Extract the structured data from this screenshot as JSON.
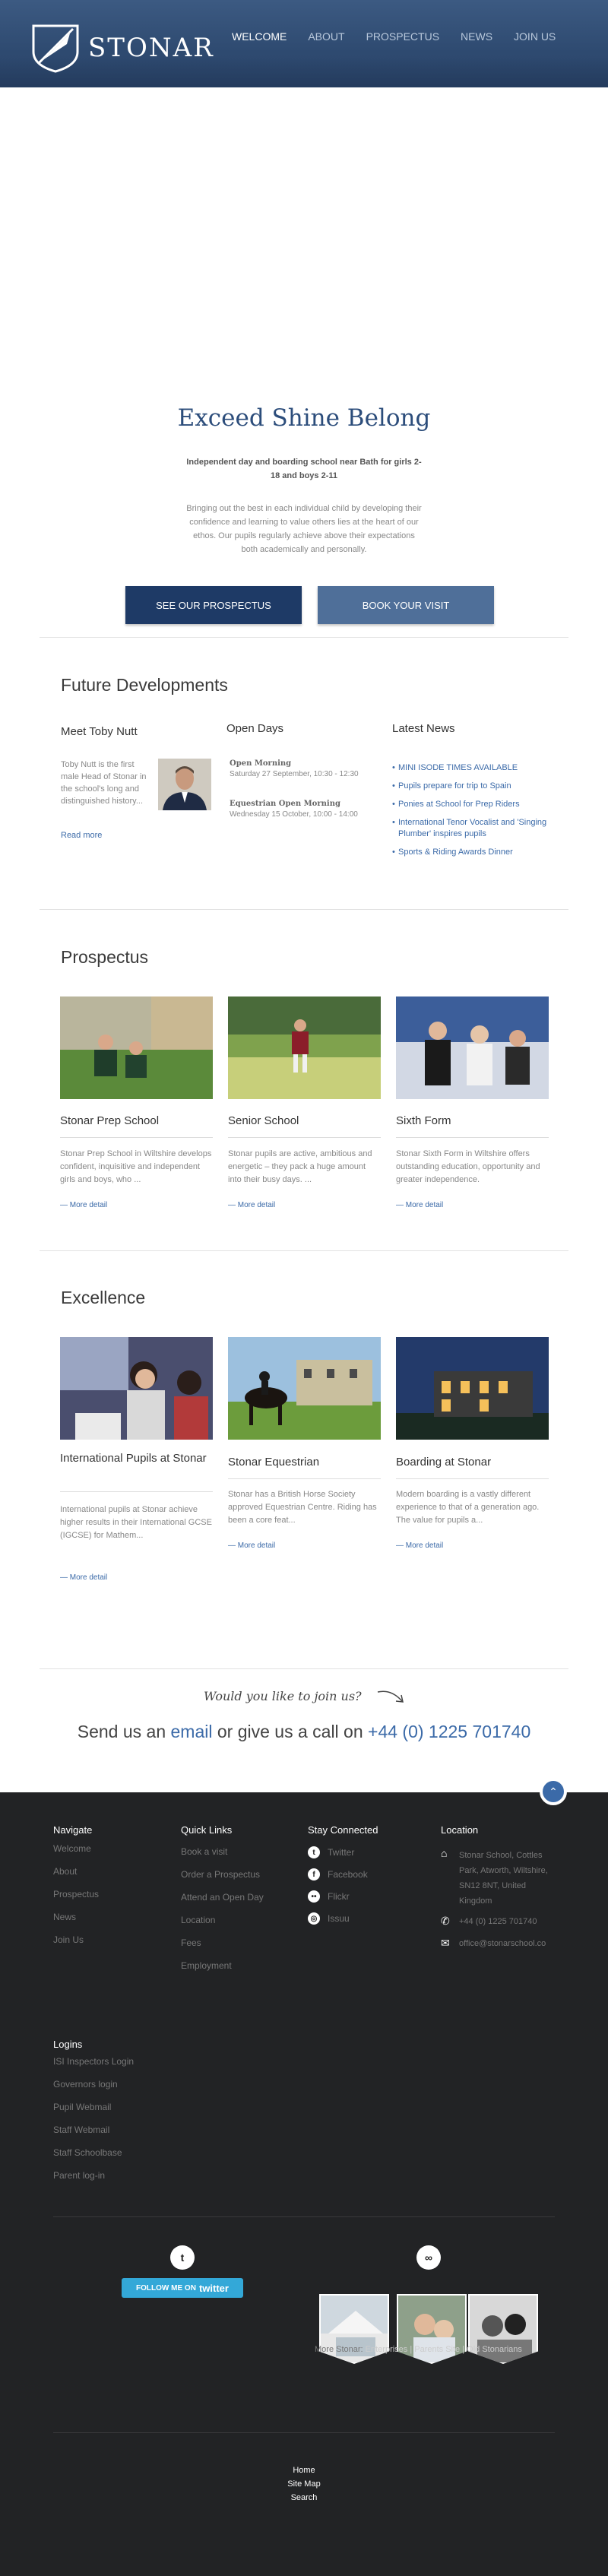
{
  "header": {
    "logo_text": "STONAR",
    "nav": [
      {
        "label": "WELCOME",
        "active": true
      },
      {
        "label": "ABOUT"
      },
      {
        "label": "PROSPECTUS"
      },
      {
        "label": "NEWS"
      },
      {
        "label": "JOIN US"
      }
    ]
  },
  "hero": {
    "title": "Exceed Shine Belong",
    "subtitle": "Independent day and boarding school near Bath for girls 2-18 and boys 2-11",
    "body": "Bringing out the best in each individual child by developing their confidence and learning to value others lies at the heart of our ethos. Our pupils regularly achieve above their expectations both academically and personally.",
    "btn_prospectus": "SEE OUR PROSPECTUS",
    "btn_visit": "BOOK YOUR VISIT"
  },
  "future": {
    "title": "Future Developments",
    "toby": {
      "heading": "Meet Toby Nutt",
      "text": "Toby Nutt is the first male Head of Stonar in the school's long and distinguished history...",
      "more": "Read more"
    },
    "open_days": {
      "heading": "Open Days",
      "events": [
        {
          "name": "Open Morning",
          "when": "Saturday 27 September, 10:30 - 12:30"
        },
        {
          "name": "Equestrian Open Morning",
          "when": "Wednesday 15 October, 10:00 - 14:00"
        }
      ]
    },
    "latest_news": {
      "heading": "Latest News",
      "items": [
        "MINI ISODE TIMES AVAILABLE",
        "Pupils prepare for trip to Spain",
        "Ponies at School for Prep Riders",
        "International Tenor Vocalist and 'Singing Plumber' inspires pupils",
        "Sports & Riding Awards Dinner"
      ]
    }
  },
  "prospectus": {
    "title": "Prospectus",
    "cards": [
      {
        "title": "Stonar Prep School",
        "text": "Stonar Prep School in Wiltshire develops confident, inquisitive and independent girls and boys, who ...",
        "more": "More detail"
      },
      {
        "title": "Senior School",
        "text": "Stonar pupils are active, ambitious and energetic – they pack a huge amount into their busy days. ...",
        "more": "More detail"
      },
      {
        "title": "Sixth Form",
        "text": "Stonar Sixth Form in Wiltshire offers outstanding education, opportunity and greater independence.",
        "more": "More detail"
      }
    ]
  },
  "excellence": {
    "title": "Excellence",
    "cards": [
      {
        "title": "International Pupils at Stonar",
        "text": "International pupils at Stonar achieve higher results in their International GCSE (IGCSE) for Mathem...",
        "more": "More detail"
      },
      {
        "title": "Stonar Equestrian",
        "text": "Stonar has a British Horse Society approved Equestrian Centre. Riding has been a core feat...",
        "more": "More detail"
      },
      {
        "title": "Boarding at Stonar",
        "text": "Modern boarding is a vastly different experience to that of a generation ago. The value for pupils a...",
        "more": "More detail"
      }
    ]
  },
  "join": {
    "script": "Would you like to join us?",
    "pre": "Send us an ",
    "email": "email",
    "mid": " or give us a call on ",
    "phone": "+44 (0) 1225 701740"
  },
  "footer": {
    "navigate": {
      "heading": "Navigate",
      "items": [
        "Welcome",
        "About",
        "Prospectus",
        "News",
        "Join Us"
      ]
    },
    "quick_links": {
      "heading": "Quick Links",
      "items": [
        "Book a visit",
        "Order a Prospectus",
        "Attend an Open Day",
        "Location",
        "Fees",
        "Employment"
      ]
    },
    "stay_connected": {
      "heading": "Stay Connected",
      "items": [
        "Twitter",
        "Facebook",
        "Flickr",
        "Issuu"
      ]
    },
    "location": {
      "heading": "Location",
      "address": "Stonar School, Cottles Park, Atworth, Wiltshire, SN12 8NT, United Kingdom",
      "phone": "+44 (0) 1225 701740",
      "email": "office@stonarschool.co"
    },
    "logins": {
      "heading": "Logins",
      "items": [
        "ISI Inspectors Login",
        "Governors login",
        "Pupil Webmail",
        "Staff Webmail",
        "Staff Schoolbase",
        "Parent log-in"
      ]
    },
    "follow": {
      "pre": "FOLLOW ME ON",
      "brand": "twitter"
    },
    "more_stonar": {
      "label": "More Stonar:",
      "links": "Enterprises | Parents Site | Old Stonarians"
    },
    "bottom": [
      "Home",
      "Site Map",
      "Search"
    ]
  },
  "colors": {
    "brand_dark": "#1e3a66",
    "link": "#3b6aa8",
    "footer_bg": "#222325"
  }
}
